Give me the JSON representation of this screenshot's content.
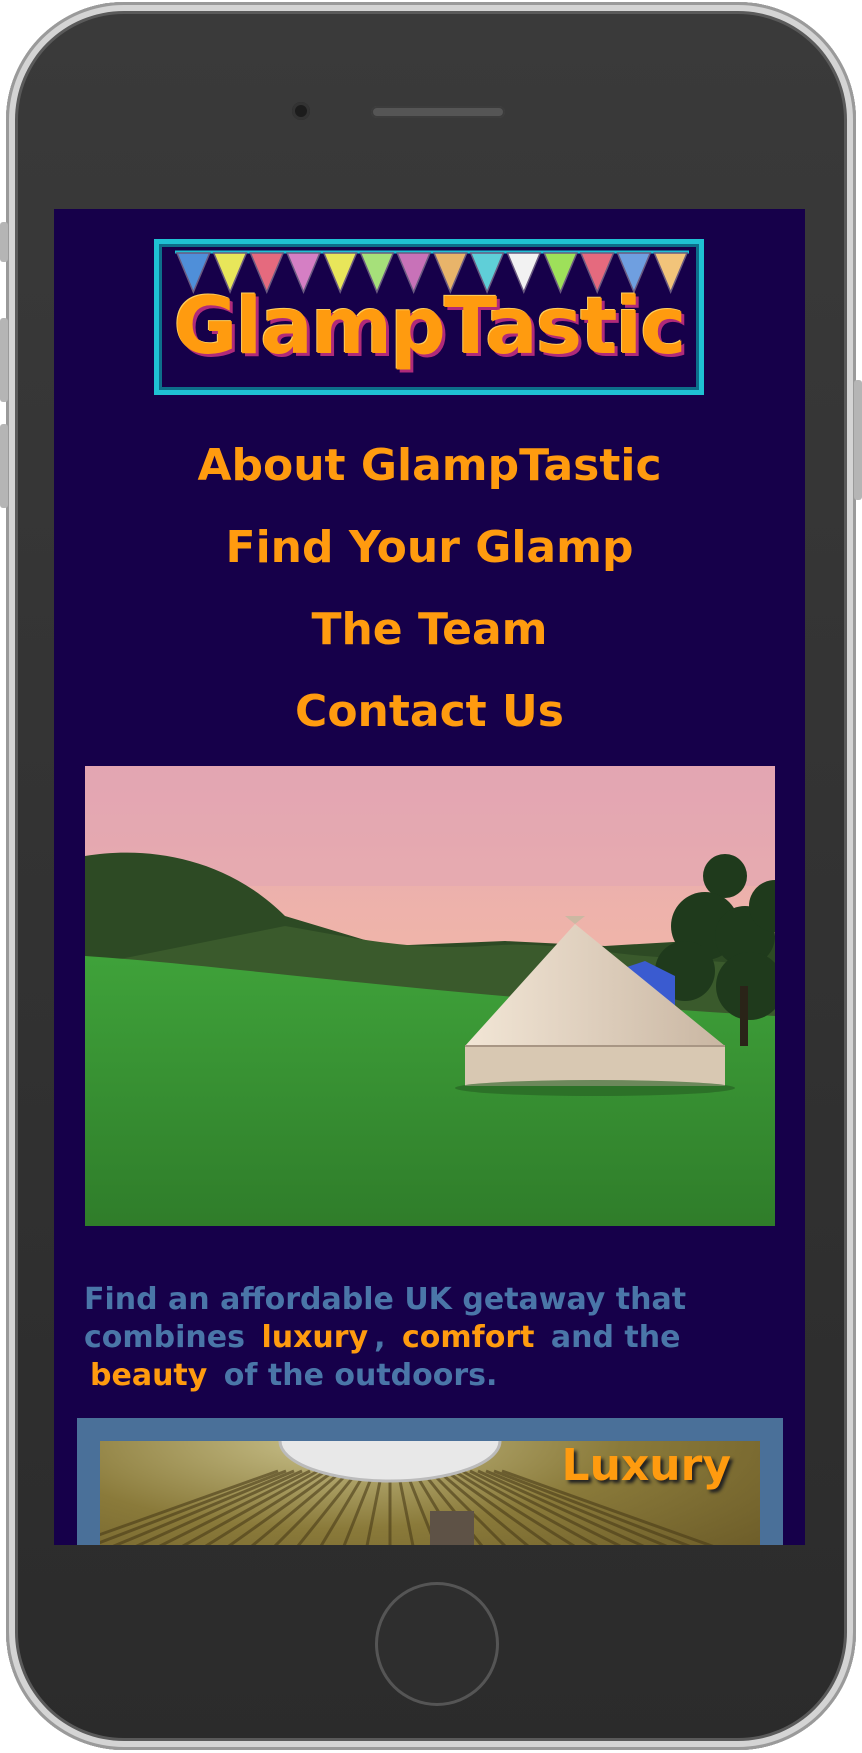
{
  "logo": {
    "text": "GlampTastic",
    "bunting_colors": [
      "#4f8fd9",
      "#e8e65a",
      "#e56a7e",
      "#d57fc4",
      "#e8e65a",
      "#a6e07a",
      "#c872b8",
      "#e8b46a",
      "#5fcfd8",
      "#f2f2f2",
      "#9ee05a",
      "#e56a7e",
      "#6f9fe0",
      "#f2c47a"
    ]
  },
  "nav": {
    "items": [
      {
        "label": "About GlampTastic"
      },
      {
        "label": "Find Your Glamp"
      },
      {
        "label": "The Team"
      },
      {
        "label": "Contact Us"
      }
    ]
  },
  "intro": {
    "part1": "Find an affordable UK getaway that combines",
    "highlight1": "luxury",
    "sep1": ",",
    "highlight2": "comfort",
    "part2": "and the",
    "highlight3": "beauty",
    "part3": "of the outdoors."
  },
  "card": {
    "title": "Luxury"
  },
  "colors": {
    "background": "#16004a",
    "accent": "#ff9b0f",
    "text": "#4a76a8",
    "logo_border": "#1fc1d3",
    "card": "#4a7099"
  }
}
